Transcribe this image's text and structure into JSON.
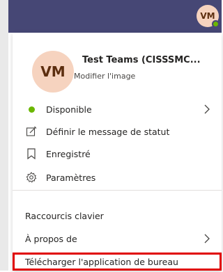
{
  "header": {
    "avatar_initials": "VM"
  },
  "profile": {
    "initials": "VM",
    "name_bold": "Test Teams",
    "name_rest": " (CISSSMC...",
    "edit_image": "Modifier l'image"
  },
  "menu": {
    "status": "Disponible",
    "set_status_message": "Définir le message de statut",
    "saved": "Enregistré",
    "settings": "Paramètres",
    "keyboard_shortcuts": "Raccourcis clavier",
    "about": "À propos de",
    "download_desktop": "Télécharger l'application de bureau"
  },
  "colors": {
    "header_bg": "#464775",
    "presence_available": "#6bb700",
    "avatar_bg": "#f6d3bf",
    "highlight_border": "#e00000"
  }
}
